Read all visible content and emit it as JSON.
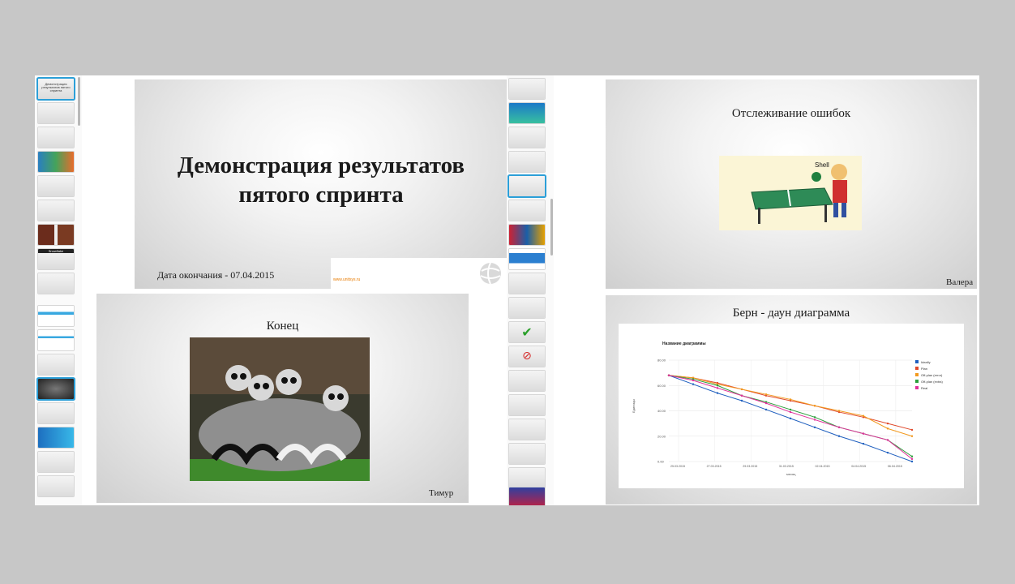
{
  "slides": {
    "title_slide": {
      "heading": "Демонстрация результатов пятого спринта",
      "date": "Дата окончания - 07.04.2015",
      "url": "www.unitsys.ru"
    },
    "end_slide": {
      "title": "Конец",
      "author": "Тимур"
    },
    "bugs_slide": {
      "title": "Отслеживание ошибок",
      "author": "Валера",
      "shell": "Shell"
    },
    "burndown_slide": {
      "title": "Берн - даун диаграмма"
    }
  },
  "thumbnails_left": {
    "first_title": "Демонстрация результатов пятого спринта",
    "snowflake_label": "Snowflake"
  },
  "colors": {
    "selection": "#2b9fd8",
    "accent_orange": "#e87b00"
  },
  "chart_data": {
    "type": "line",
    "title": "Название диаграммы",
    "xlabel": "месяц",
    "ylabel": "Единицы",
    "ylim": [
      0,
      80
    ],
    "yticks": [
      "0.00",
      "20.00",
      "40.00",
      "60.00",
      "80.00"
    ],
    "xticklabels": [
      "25.03.2015",
      "27.03.2015",
      "29.03.2015",
      "31.03.2015",
      "02.04.2015",
      "04.04.2015",
      "06.04.2015"
    ],
    "series": [
      {
        "name": "Ideally",
        "color": "#1f5fbf",
        "values": [
          68,
          61,
          54,
          48,
          41,
          34,
          27,
          20,
          14,
          7,
          0
        ]
      },
      {
        "name": "Plan",
        "color": "#e0492b",
        "values": [
          68,
          66,
          62,
          57,
          52,
          48,
          44,
          39,
          35,
          30,
          25
        ]
      },
      {
        "name": "Off-plan (error)",
        "color": "#f29a1f",
        "values": [
          68,
          66,
          61,
          57,
          53,
          49,
          44,
          40,
          36,
          26,
          20
        ]
      },
      {
        "name": "Off-plan (extra)",
        "color": "#2b9f3b",
        "values": [
          68,
          65,
          60,
          52,
          47,
          41,
          35,
          27,
          22,
          17,
          4
        ]
      },
      {
        "name": "Real",
        "color": "#e0309a",
        "values": [
          68,
          64,
          58,
          52,
          46,
          39,
          33,
          27,
          22,
          17,
          2
        ]
      }
    ]
  }
}
